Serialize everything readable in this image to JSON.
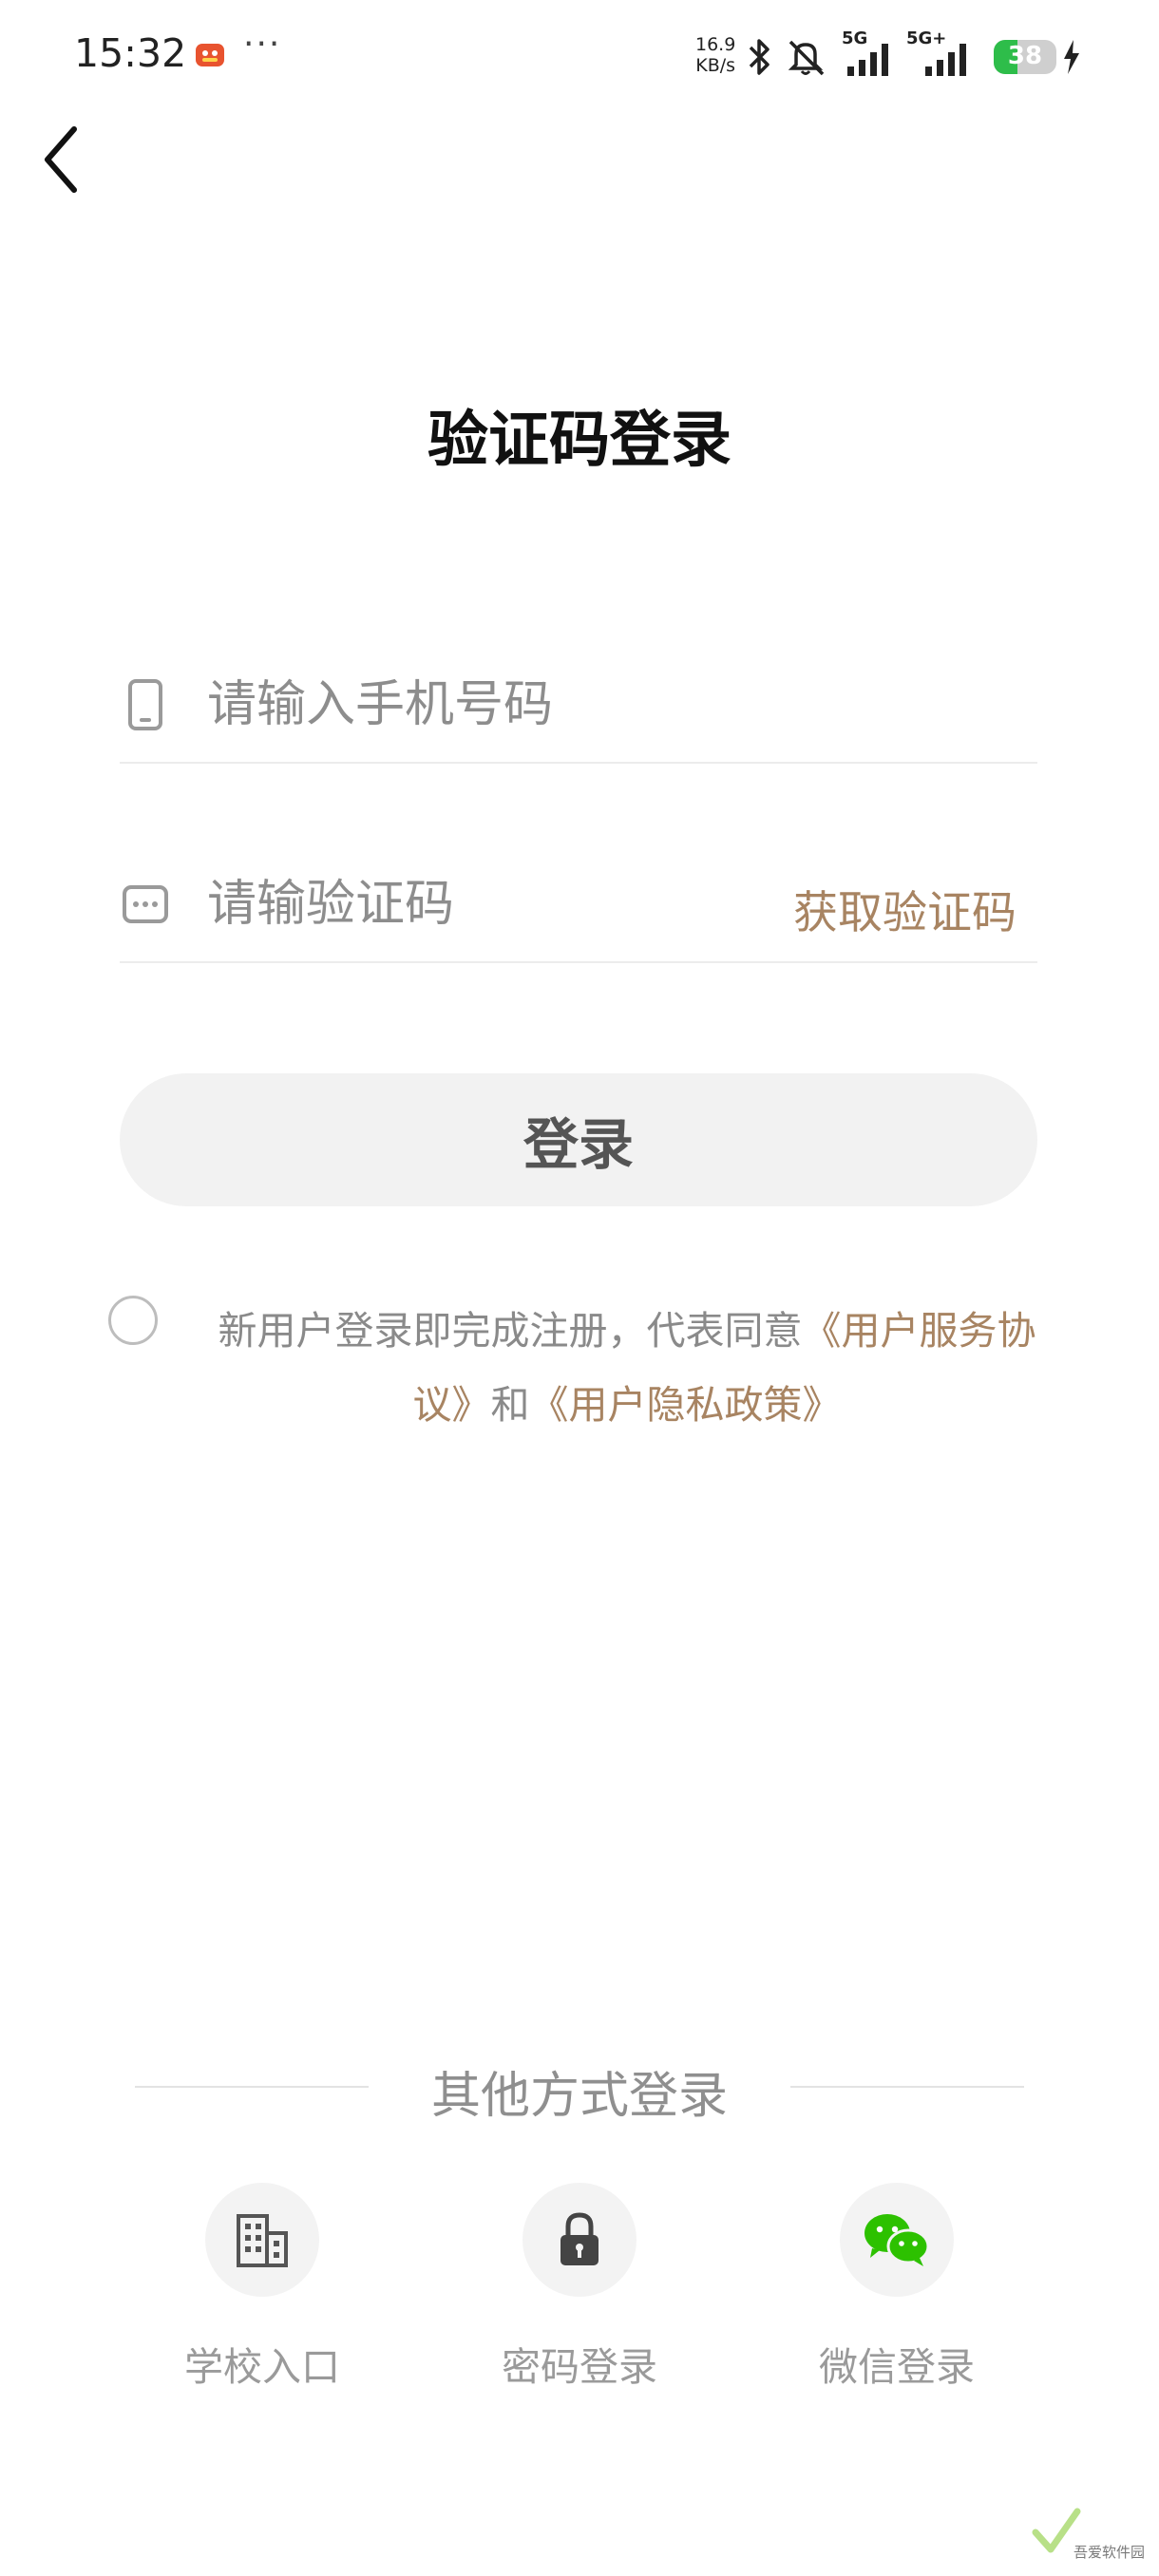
{
  "status_bar": {
    "time": "15:32",
    "dots": "···",
    "net_speed_value": "16.9",
    "net_speed_unit": "KB/s",
    "sim1_label": "5G",
    "sim2_label": "5G+",
    "battery_level": "38",
    "battery_fraction": 0.38,
    "colors": {
      "battery": "#2ebd4a"
    }
  },
  "header": {
    "title": "验证码登录"
  },
  "form": {
    "phone_placeholder": "请输入手机号码",
    "code_placeholder": "请输验证码",
    "get_code_label": "获取验证码",
    "login_label": "登录"
  },
  "agreement": {
    "prefix": "新用户登录即完成注册，代表同意",
    "service_link": "《用户服务协议》",
    "and_text": "和",
    "privacy_link": "《用户隐私政策》"
  },
  "other_login": {
    "title": "其他方式登录",
    "options": [
      {
        "label": "学校入口",
        "icon": "building-icon"
      },
      {
        "label": "密码登录",
        "icon": "lock-icon"
      },
      {
        "label": "微信登录",
        "icon": "wechat-icon"
      }
    ]
  },
  "watermark": {
    "text": "吾爱软件园"
  },
  "colors": {
    "accent": "#a88462",
    "wechat": "#2dc100"
  }
}
